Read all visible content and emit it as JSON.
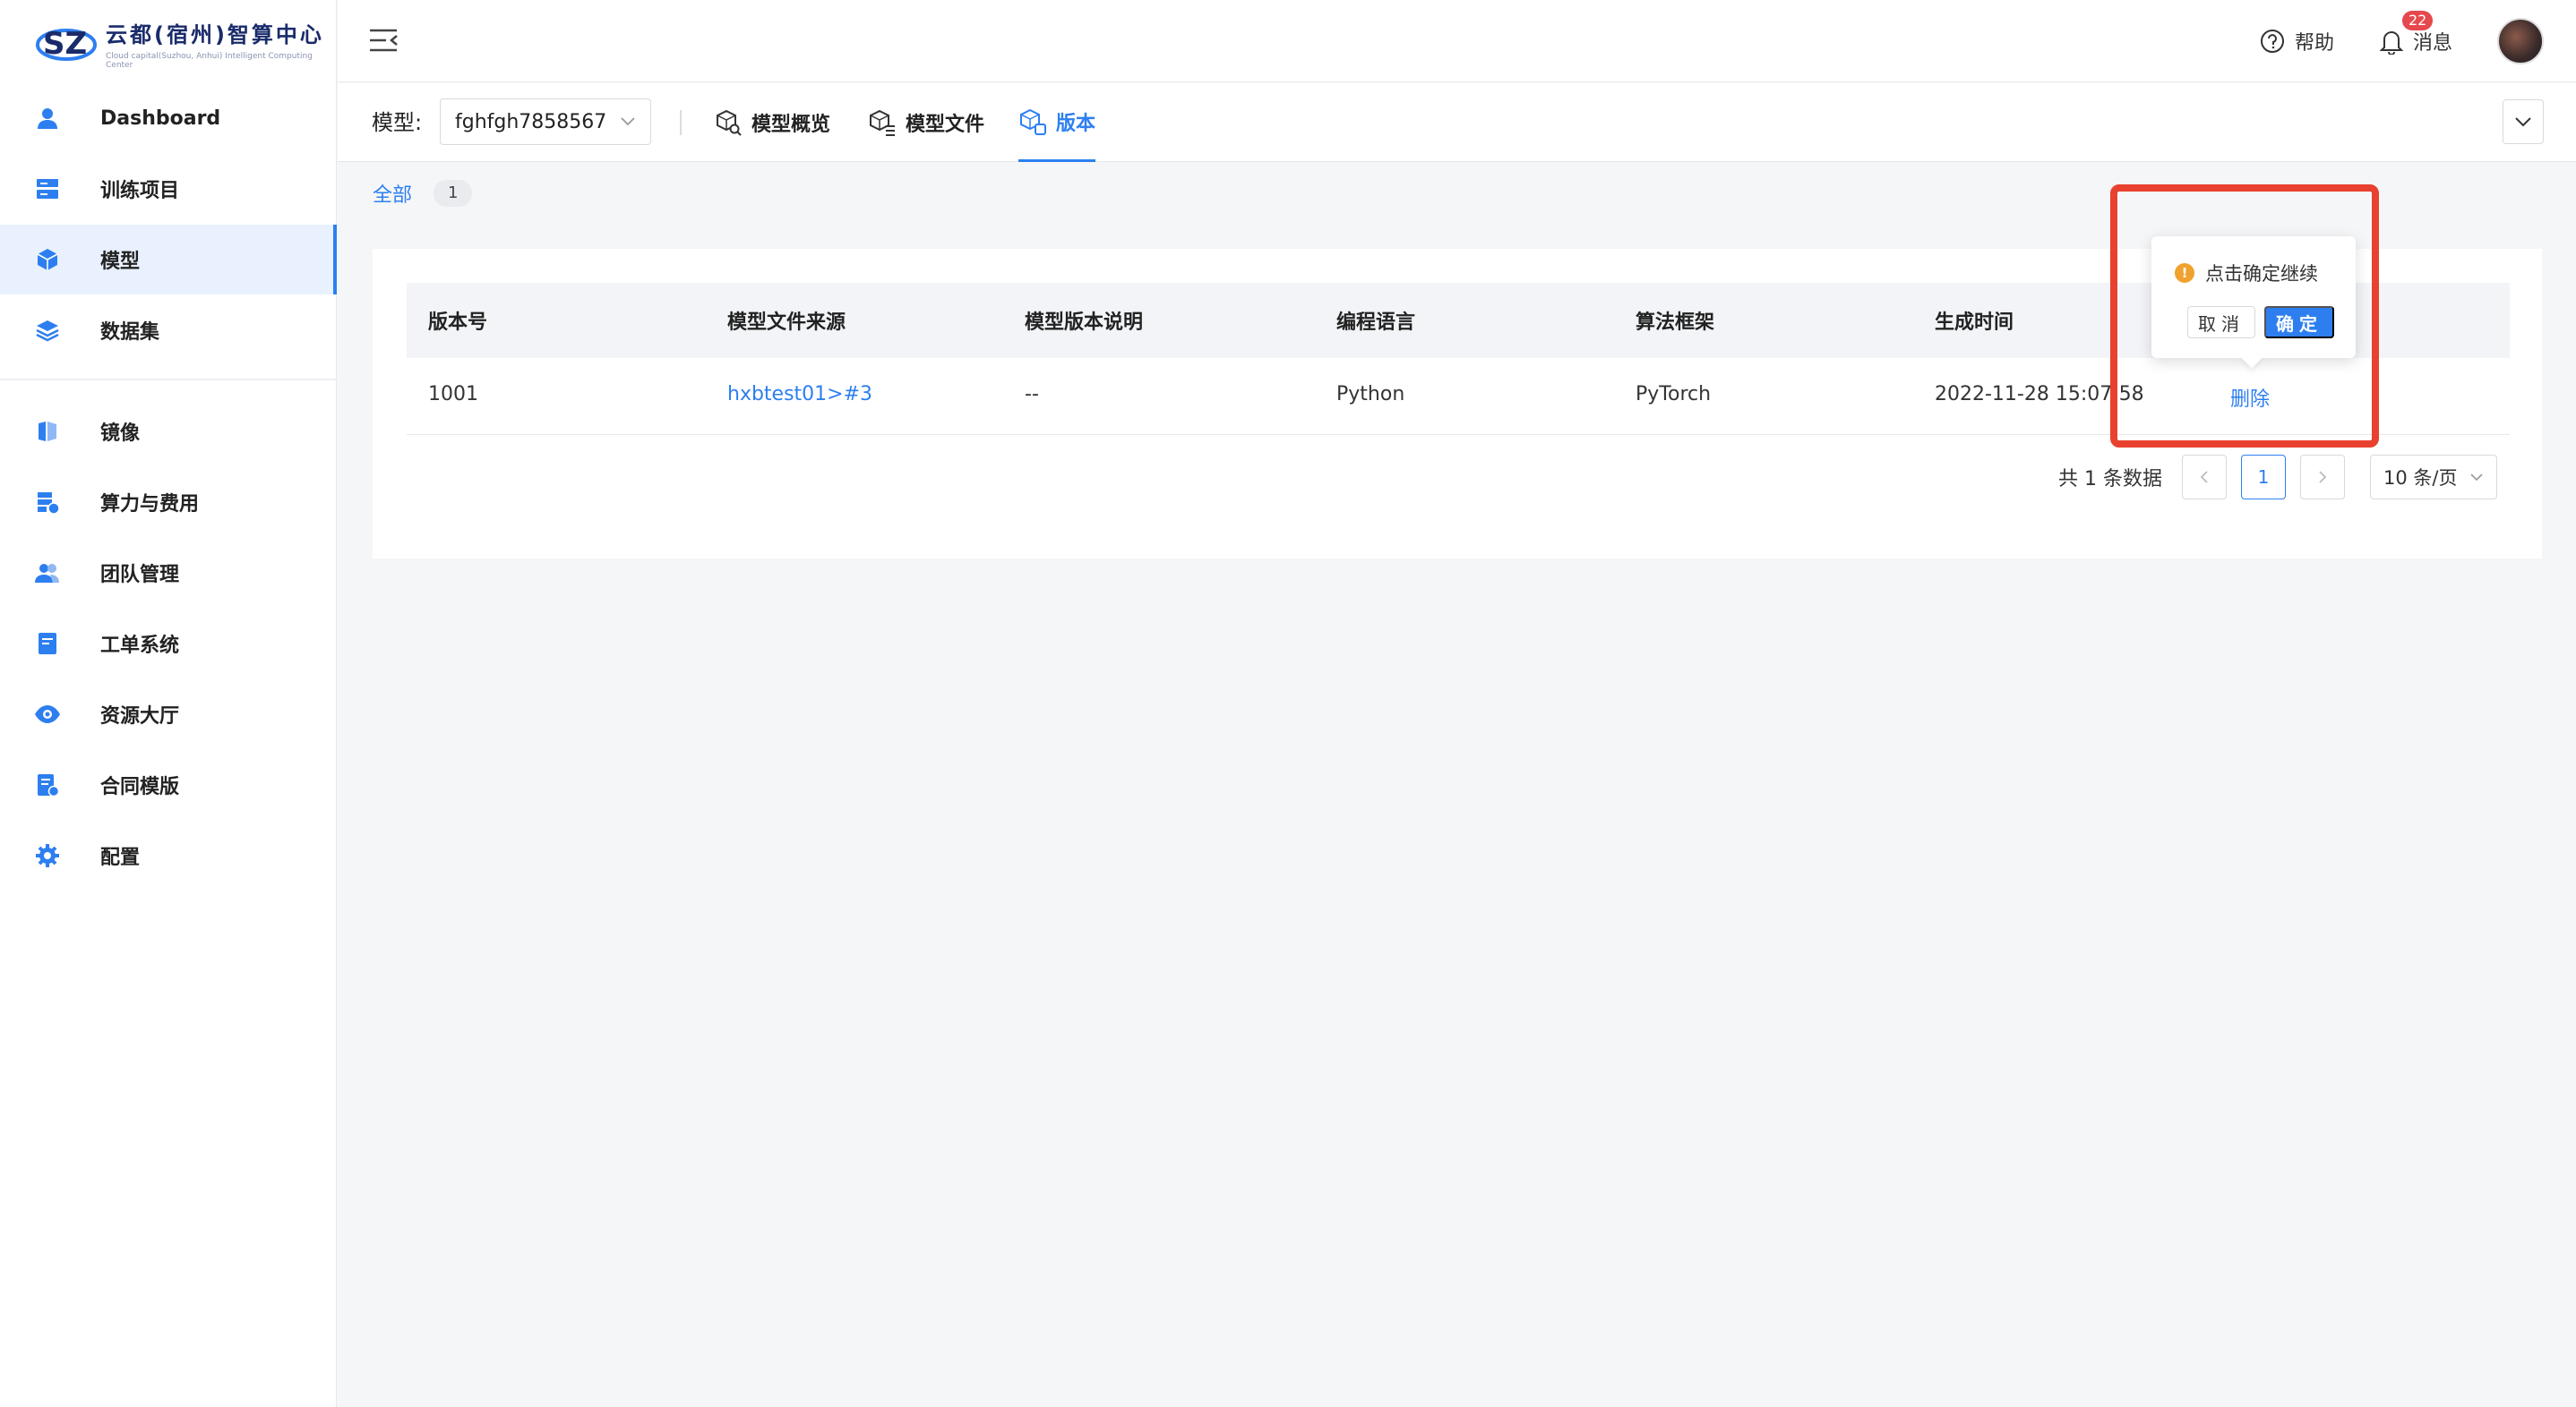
{
  "logo": {
    "title": "云都(宿州)智算中心",
    "subtitle": "Cloud capital(Suzhou, Anhui) Intelligent Computing Center"
  },
  "sidebar": {
    "items": [
      {
        "label": "Dashboard",
        "icon": "user-icon",
        "active": false
      },
      {
        "label": "训练项目",
        "icon": "server-icon",
        "active": false
      },
      {
        "label": "模型",
        "icon": "cube-icon",
        "active": true
      },
      {
        "label": "数据集",
        "icon": "layers-icon",
        "active": false
      },
      {
        "label": "镜像",
        "icon": "mirror-icon",
        "active": false
      },
      {
        "label": "算力与费用",
        "icon": "compute-cost-icon",
        "active": false
      },
      {
        "label": "团队管理",
        "icon": "team-icon",
        "active": false
      },
      {
        "label": "工单系统",
        "icon": "ticket-icon",
        "active": false
      },
      {
        "label": "资源大厅",
        "icon": "eye-icon",
        "active": false
      },
      {
        "label": "合同模版",
        "icon": "contract-icon",
        "active": false
      },
      {
        "label": "配置",
        "icon": "gear-icon",
        "active": false
      }
    ]
  },
  "topbar": {
    "help": "帮助",
    "messages": "消息",
    "message_count": "22"
  },
  "subbar": {
    "model_label": "模型:",
    "model_value": "fghfgh7858567",
    "tabs": [
      {
        "label": "模型概览",
        "active": false
      },
      {
        "label": "模型文件",
        "active": false
      },
      {
        "label": "版本",
        "active": true
      }
    ]
  },
  "filter": {
    "all": "全部",
    "count": "1"
  },
  "table": {
    "headers": [
      "版本号",
      "模型文件来源",
      "模型版本说明",
      "编程语言",
      "算法框架",
      "生成时间"
    ],
    "rows": [
      {
        "version": "1001",
        "source": "hxbtest01>#3",
        "desc": "--",
        "lang": "Python",
        "framework": "PyTorch",
        "time": "2022-11-28 15:07:58",
        "action": "删除"
      }
    ]
  },
  "pagination": {
    "total": "共 1 条数据",
    "current": "1",
    "page_size": "10 条/页"
  },
  "popconfirm": {
    "message": "点击确定继续",
    "cancel": "取消",
    "ok": "确定"
  },
  "colors": {
    "accent": "#2d7ff0",
    "highlight": "#e8412f",
    "warning": "#f0a22e"
  }
}
